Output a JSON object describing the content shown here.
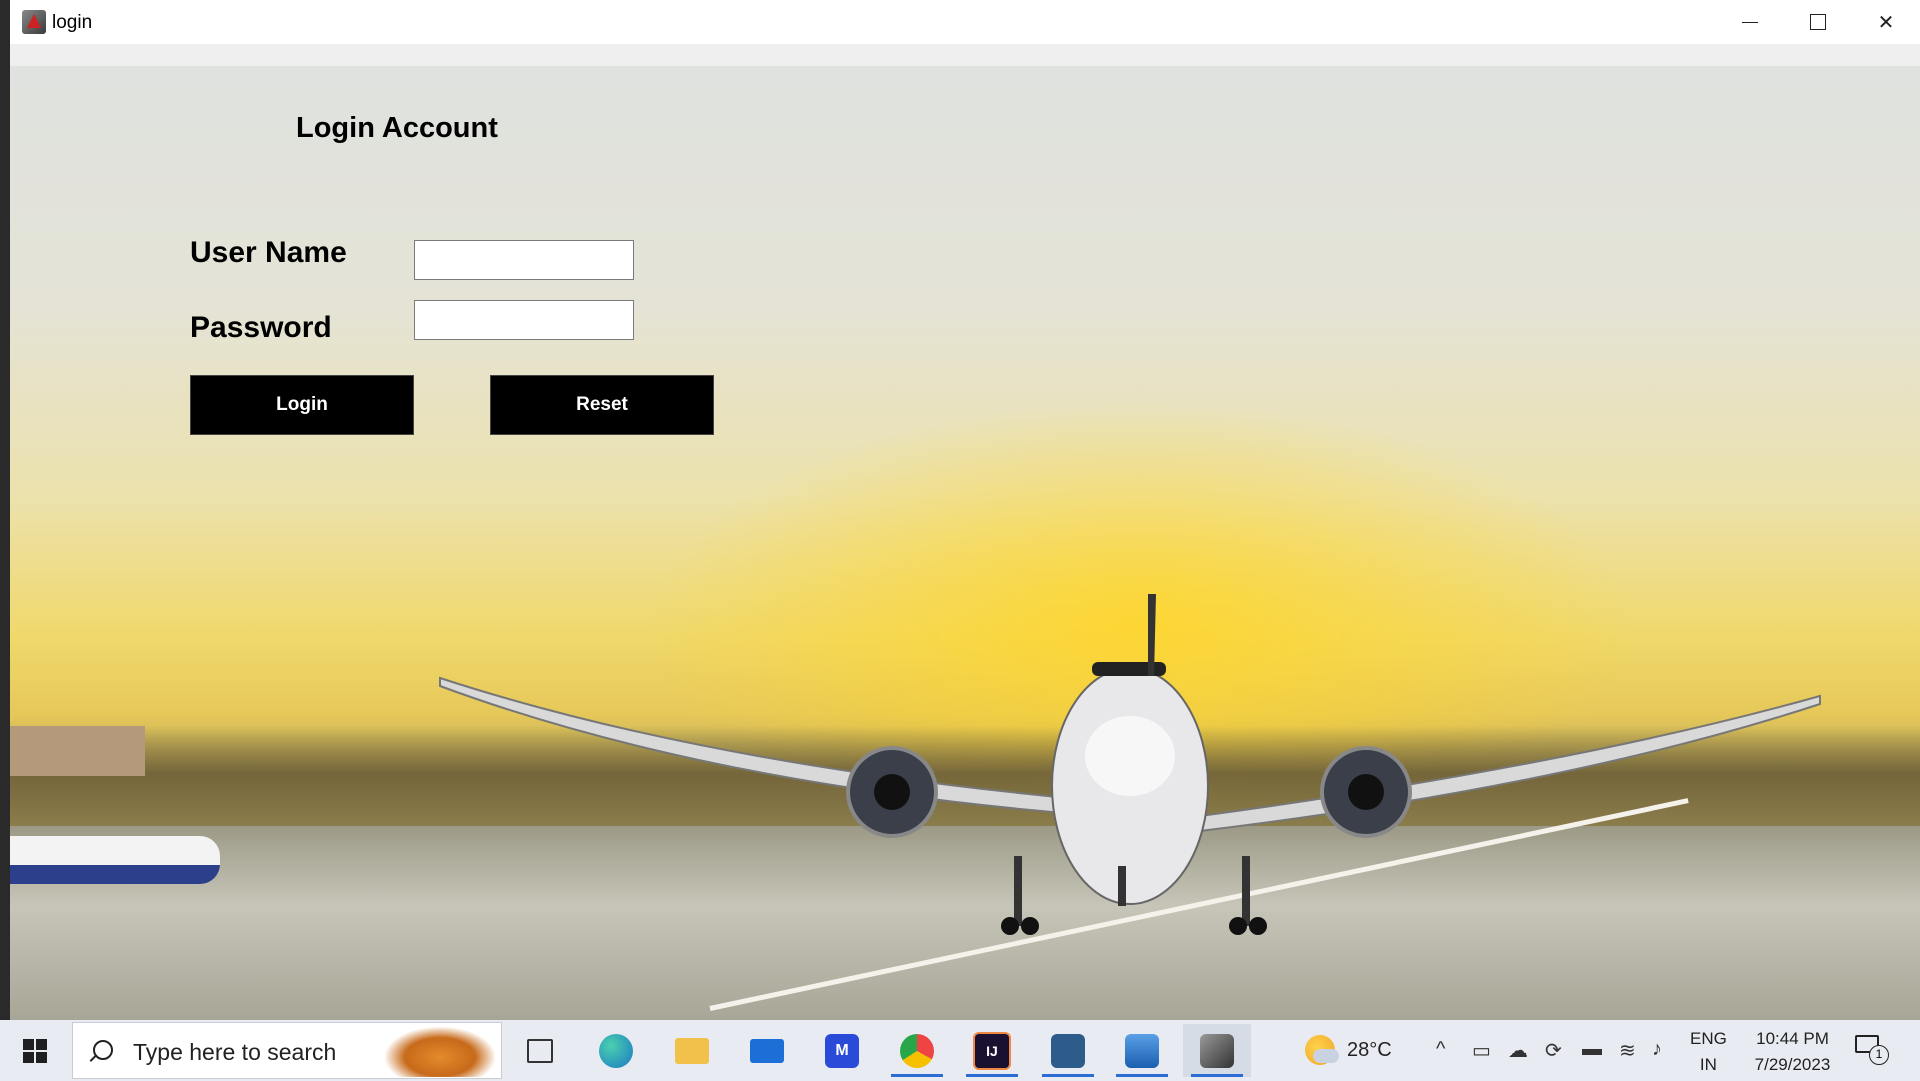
{
  "window": {
    "title": "login"
  },
  "form": {
    "heading": "Login Account",
    "username_label": "User Name",
    "password_label": "Password",
    "username_value": "",
    "password_value": "",
    "login_button": "Login",
    "reset_button": "Reset"
  },
  "taskbar": {
    "search_placeholder": "Type here to search",
    "apps": [
      {
        "name": "task-view",
        "icon": "task-view-icon"
      },
      {
        "name": "edge",
        "icon": "edge-icon"
      },
      {
        "name": "file-explorer",
        "icon": "folder-icon"
      },
      {
        "name": "mail",
        "icon": "mail-icon"
      },
      {
        "name": "app-m",
        "icon": "m-app-icon"
      },
      {
        "name": "chrome",
        "icon": "chrome-icon"
      },
      {
        "name": "intellij",
        "icon": "intellij-icon"
      },
      {
        "name": "mysql",
        "icon": "mysql-icon"
      },
      {
        "name": "photos",
        "icon": "photos-icon"
      },
      {
        "name": "java",
        "icon": "java-icon"
      }
    ],
    "weather": "28°C",
    "lang_top": "ENG",
    "lang_bottom": "IN",
    "time": "10:44 PM",
    "date": "7/29/2023",
    "notification_count": "1"
  },
  "colors": {
    "button_bg": "#000000",
    "button_text": "#ffffff",
    "taskbar_accent": "#2b6dd4"
  }
}
